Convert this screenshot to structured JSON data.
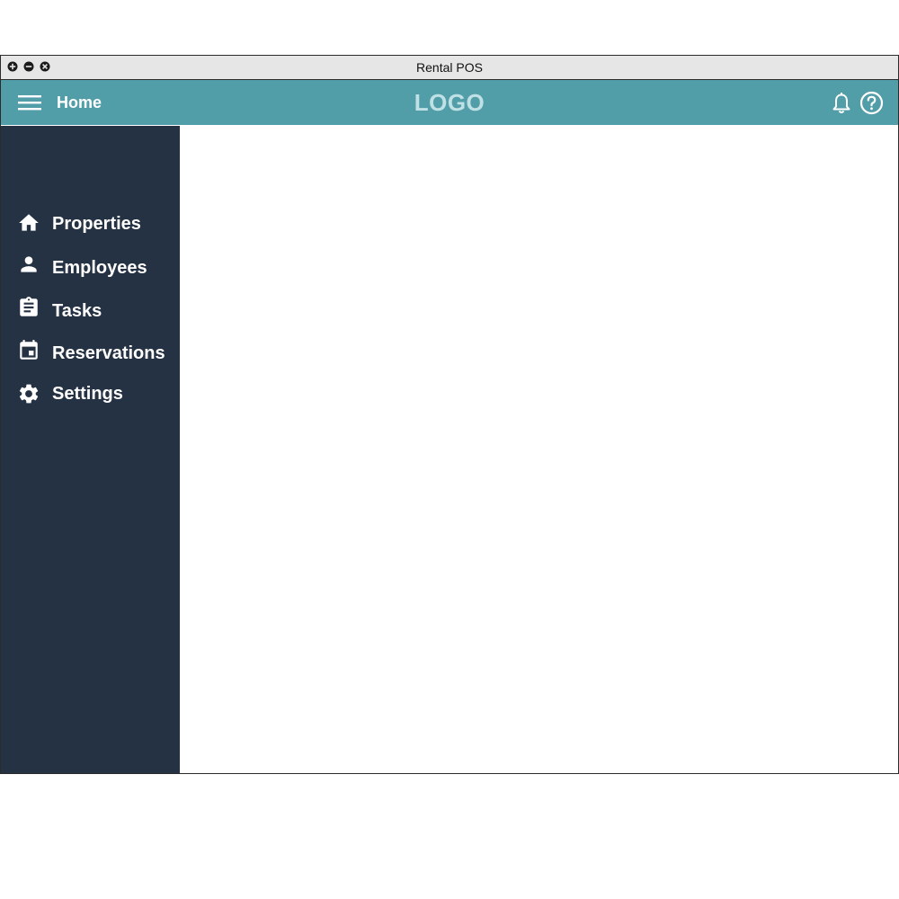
{
  "window": {
    "title": "Rental POS"
  },
  "appbar": {
    "page_label": "Home",
    "logo_text": "LOGO",
    "color": "#519ea8"
  },
  "sidebar": {
    "color": "#253243",
    "items": [
      {
        "label": "Properties",
        "icon": "home-icon"
      },
      {
        "label": "Employees",
        "icon": "person-icon"
      },
      {
        "label": "Tasks",
        "icon": "clipboard-icon"
      },
      {
        "label": "Reservations",
        "icon": "calendar-icon"
      },
      {
        "label": "Settings",
        "icon": "gear-icon"
      }
    ]
  }
}
